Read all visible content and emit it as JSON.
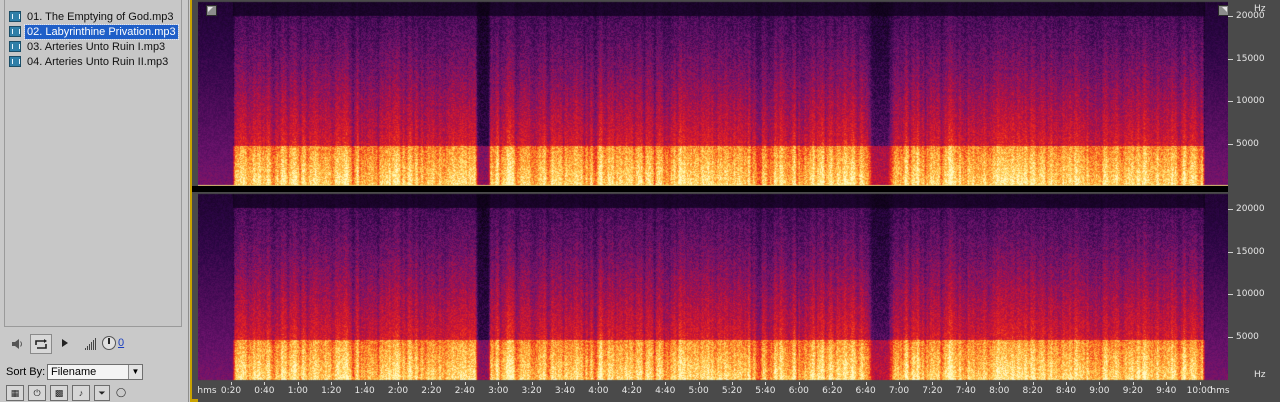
{
  "files": [
    {
      "name": "01. The Emptying of God.mp3",
      "selected": false
    },
    {
      "name": "02. Labyrinthine Privation.mp3",
      "selected": true
    },
    {
      "name": "03. Arteries Unto Ruin I.mp3",
      "selected": false
    },
    {
      "name": "04. Arteries Unto Ruin II.mp3",
      "selected": false
    }
  ],
  "transport": {
    "speaker_icon": "speaker-icon",
    "loop_icon": "loop-icon",
    "play_icon": "play-icon",
    "volume_meter_icon": "volume-meter-icon",
    "volume_knob_icon": "volume-knob-icon",
    "volume_value": "0"
  },
  "sort": {
    "label": "Sort By:",
    "selected": "Filename"
  },
  "bottom_tools": [
    "import-icon",
    "power-icon",
    "film-icon",
    "music-note-icon",
    "filter-icon",
    "link-icon"
  ],
  "spectral": {
    "freq_unit": "Hz",
    "freq_labels": [
      "20000",
      "15000",
      "10000",
      "5000"
    ],
    "time_unit": "hms",
    "time_labels": [
      "0:20",
      "0:40",
      "1:00",
      "1:20",
      "1:40",
      "2:00",
      "2:20",
      "2:40",
      "3:00",
      "3:20",
      "3:40",
      "4:00",
      "4:20",
      "4:40",
      "5:00",
      "5:20",
      "5:40",
      "6:00",
      "6:20",
      "6:40",
      "7:00",
      "7:20",
      "7:40",
      "8:00",
      "8:20",
      "8:40",
      "9:00",
      "9:20",
      "9:40",
      "10:00"
    ],
    "colors": {
      "low": "#1a0520",
      "mid": "#c8102a",
      "high": "#ffe890",
      "background": "#4a4a4a",
      "accent": "#c8a200"
    }
  }
}
